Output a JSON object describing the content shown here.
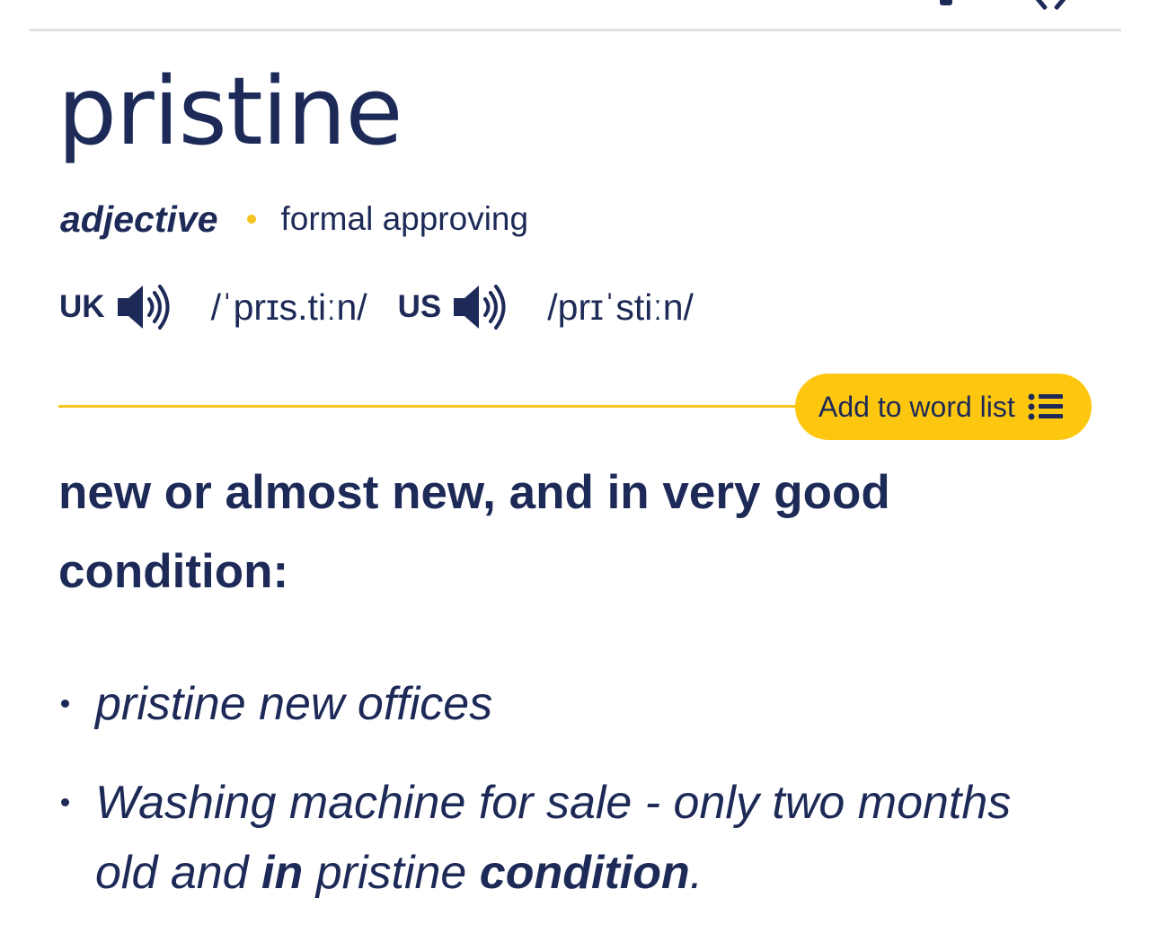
{
  "entry": {
    "headword": "pristine",
    "part_of_speech": "adjective",
    "usage_labels": "formal approving"
  },
  "pronunciation": {
    "uk": {
      "region": "UK",
      "ipa": "/ˈprɪs.tiːn/",
      "audio_icon": "speaker-icon"
    },
    "us": {
      "region": "US",
      "ipa": "/prɪˈstiːn/",
      "audio_icon": "speaker-icon"
    }
  },
  "actions": {
    "add_to_word_list": "Add to word list",
    "add_to_word_list_icon": "list-icon"
  },
  "definition": {
    "text": "new or almost new, and in very good condition:"
  },
  "examples": [
    {
      "segments": [
        {
          "text": "pristine new offices",
          "bold": false
        }
      ]
    },
    {
      "segments": [
        {
          "text": "Washing machine for sale - only two months old and ",
          "bold": false
        },
        {
          "text": "in",
          "bold": true
        },
        {
          "text": " pristine ",
          "bold": false
        },
        {
          "text": "condition",
          "bold": true
        },
        {
          "text": ".",
          "bold": false
        }
      ]
    }
  ],
  "colors": {
    "text": "#1d2a57",
    "accent_yellow": "#fec70f",
    "rule_yellow": "#f6c21c",
    "top_rule": "#e1e2e6"
  }
}
